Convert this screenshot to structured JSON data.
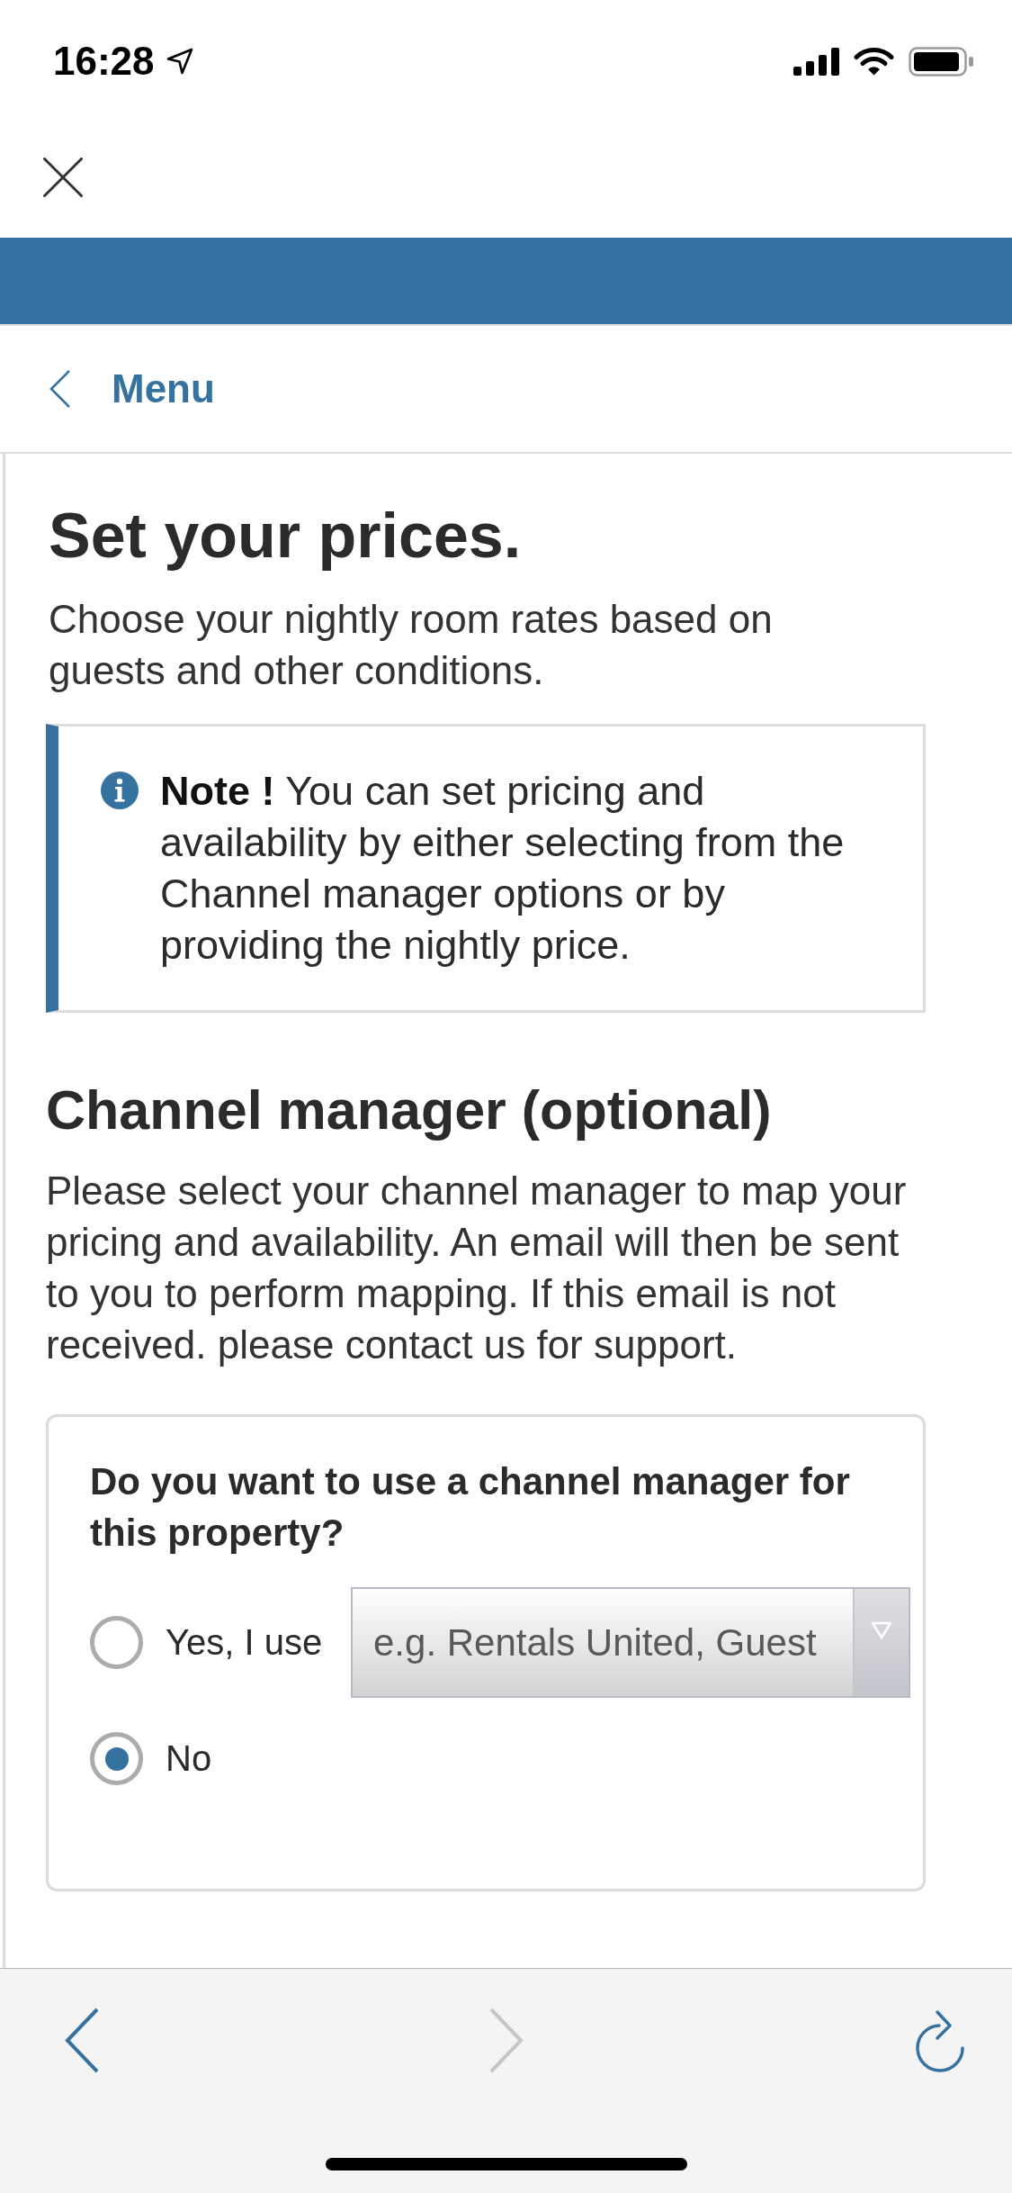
{
  "status_bar": {
    "time": "16:28"
  },
  "nav": {
    "back_label": "Menu"
  },
  "page": {
    "title": "Set your prices.",
    "subtitle": "Choose your nightly room rates based on guests and other conditions."
  },
  "note": {
    "text": "**Note !** You can set pricing and availability by either selecting from the Channel manager options or by providing the nightly price."
  },
  "channel_manager": {
    "title": "Channel manager (optional)",
    "description": "Please select your channel manager to map your pricing and availability. An email will then be sent to you to perform mapping. If this email is not received. please contact us for support.",
    "question": "Do you want to use a channel manager for this property?",
    "options": [
      {
        "label": "Yes, I use",
        "selected": false,
        "kind": "select",
        "placeholder": "e.g. Rentals United, Guest"
      },
      {
        "label": "No",
        "selected": true,
        "kind": "plain"
      }
    ]
  },
  "browser_toolbar": {
    "buttons": [
      {
        "kind": "back",
        "disabled": false
      },
      {
        "kind": "forward",
        "disabled": true
      },
      {
        "kind": "reload",
        "disabled": false
      }
    ]
  }
}
